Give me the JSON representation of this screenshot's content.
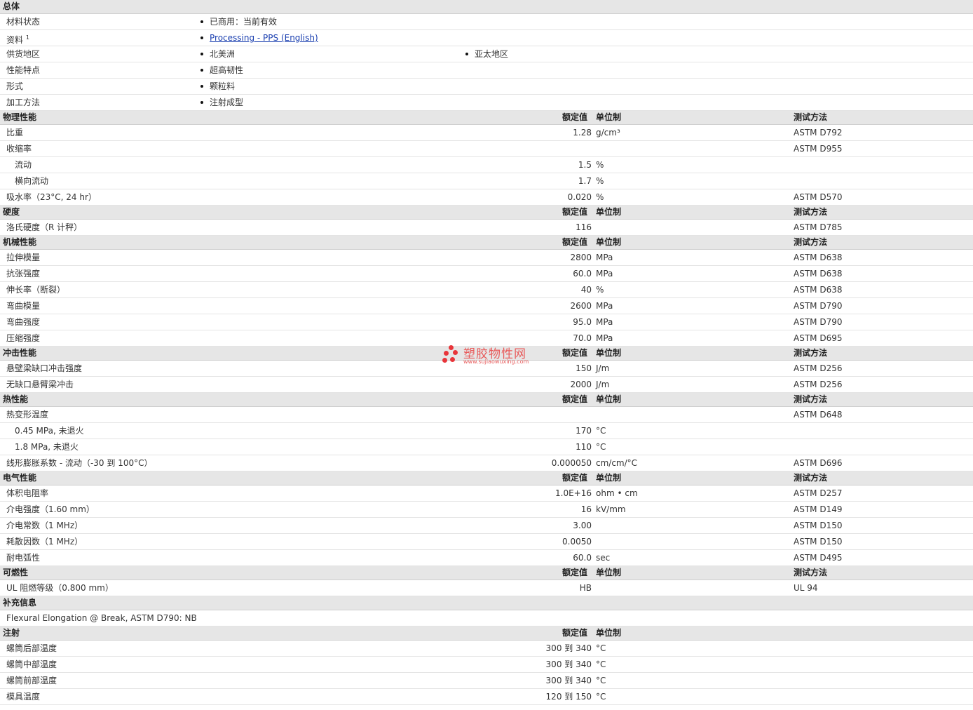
{
  "columns": {
    "value": "额定值",
    "unit": "单位制",
    "method": "测试方法"
  },
  "general": {
    "title": "总体",
    "rows": [
      {
        "label": "材料状态",
        "items": [
          "已商用：当前有效"
        ]
      },
      {
        "label": "资料",
        "sup": "1",
        "link": "Processing - PPS (English)"
      },
      {
        "label": "供货地区",
        "items": [
          "北美洲",
          "亚太地区"
        ]
      },
      {
        "label": "性能特点",
        "items": [
          "超高韧性"
        ]
      },
      {
        "label": "形式",
        "items": [
          "颗粒料"
        ]
      },
      {
        "label": "加工方法",
        "items": [
          "注射成型"
        ]
      }
    ]
  },
  "physical": {
    "title": "物理性能",
    "rows": [
      {
        "label": "比重",
        "value": "1.28",
        "unit": "g/cm³",
        "method": "ASTM D792"
      },
      {
        "label": "收缩率",
        "value": "",
        "unit": "",
        "method": "ASTM D955"
      },
      {
        "label": "流动",
        "value": "1.5",
        "unit": "%",
        "method": "",
        "sub": true
      },
      {
        "label": "横向流动",
        "value": "1.7",
        "unit": "%",
        "method": "",
        "sub": true
      },
      {
        "label": "吸水率（23°C, 24 hr）",
        "value": "0.020",
        "unit": "%",
        "method": "ASTM D570"
      }
    ]
  },
  "hardness": {
    "title": "硬度",
    "rows": [
      {
        "label": "洛氏硬度（R 计秤）",
        "value": "116",
        "unit": "",
        "method": "ASTM D785"
      }
    ]
  },
  "mechanical": {
    "title": "机械性能",
    "rows": [
      {
        "label": "拉伸模量",
        "value": "2800",
        "unit": "MPa",
        "method": "ASTM D638"
      },
      {
        "label": "抗张强度",
        "value": "60.0",
        "unit": "MPa",
        "method": "ASTM D638"
      },
      {
        "label": "伸长率（断裂）",
        "value": "40",
        "unit": "%",
        "method": "ASTM D638"
      },
      {
        "label": "弯曲模量",
        "value": "2600",
        "unit": "MPa",
        "method": "ASTM D790"
      },
      {
        "label": "弯曲强度",
        "value": "95.0",
        "unit": "MPa",
        "method": "ASTM D790"
      },
      {
        "label": "压缩强度",
        "value": "70.0",
        "unit": "MPa",
        "method": "ASTM D695"
      }
    ]
  },
  "impact": {
    "title": "冲击性能",
    "rows": [
      {
        "label": "悬壁梁缺口冲击强度",
        "value": "150",
        "unit": "J/m",
        "method": "ASTM D256"
      },
      {
        "label": "无缺口悬臂梁冲击",
        "value": "2000",
        "unit": "J/m",
        "method": "ASTM D256"
      }
    ]
  },
  "thermal": {
    "title": "热性能",
    "rows": [
      {
        "label": "热变形温度",
        "value": "",
        "unit": "",
        "method": "ASTM D648"
      },
      {
        "label": "0.45 MPa, 未退火",
        "value": "170",
        "unit": "°C",
        "method": "",
        "sub": true
      },
      {
        "label": "1.8 MPa, 未退火",
        "value": "110",
        "unit": "°C",
        "method": "",
        "sub": true
      },
      {
        "label": "线形膨胀系数 - 流动（-30 到 100°C）",
        "value": "0.000050",
        "unit": "cm/cm/°C",
        "method": "ASTM D696"
      }
    ]
  },
  "electrical": {
    "title": "电气性能",
    "rows": [
      {
        "label": "体积电阻率",
        "value": "1.0E+16",
        "unit": "ohm • cm",
        "method": "ASTM D257"
      },
      {
        "label": "介电强度（1.60 mm）",
        "value": "16",
        "unit": "kV/mm",
        "method": "ASTM D149"
      },
      {
        "label": "介电常数（1 MHz）",
        "value": "3.00",
        "unit": "",
        "method": "ASTM D150"
      },
      {
        "label": "耗散因数（1 MHz）",
        "value": "0.0050",
        "unit": "",
        "method": "ASTM D150"
      },
      {
        "label": "耐电弧性",
        "value": "60.0",
        "unit": "sec",
        "method": "ASTM D495"
      }
    ]
  },
  "flammability": {
    "title": "可燃性",
    "rows": [
      {
        "label": "UL 阻燃等级（0.800 mm）",
        "value": "HB",
        "unit": "",
        "method": "UL 94"
      }
    ]
  },
  "supplemental": {
    "title": "补充信息",
    "note": "Flexural Elongation @ Break, ASTM D790: NB"
  },
  "injection": {
    "title": "注射",
    "rows": [
      {
        "label": "螺筒后部温度",
        "value": "300 到 340",
        "unit": "°C"
      },
      {
        "label": "螺筒中部温度",
        "value": "300 到 340",
        "unit": "°C"
      },
      {
        "label": "螺筒前部温度",
        "value": "300 到 340",
        "unit": "°C"
      },
      {
        "label": "模具温度",
        "value": "120 到 150",
        "unit": "°C"
      }
    ]
  },
  "watermark": {
    "name": "塑胶物性网",
    "url": "www.sujiaowuxing.com",
    "color": "#e8353a"
  }
}
